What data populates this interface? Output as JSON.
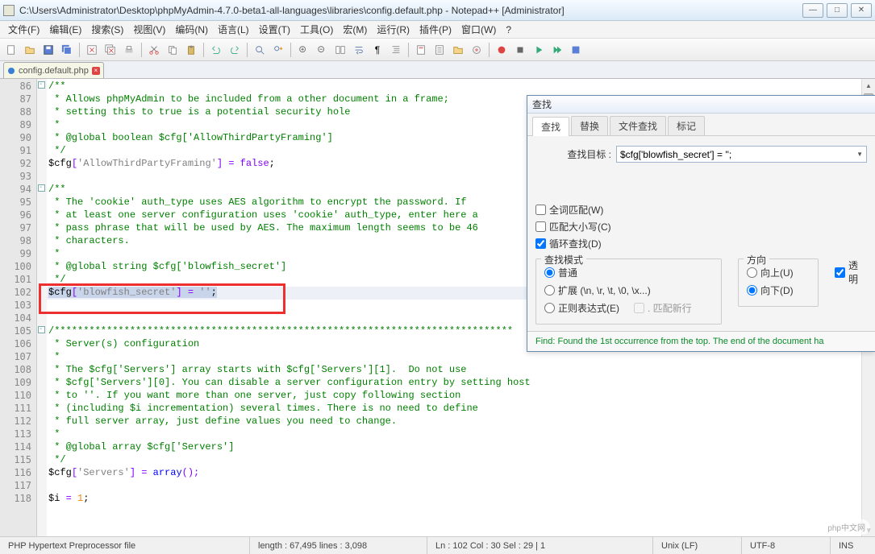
{
  "window": {
    "title": "C:\\Users\\Administrator\\Desktop\\phpMyAdmin-4.7.0-beta1-all-languages\\libraries\\config.default.php - Notepad++ [Administrator]"
  },
  "menu": {
    "items": [
      "文件(F)",
      "编辑(E)",
      "搜索(S)",
      "视图(V)",
      "编码(N)",
      "语言(L)",
      "设置(T)",
      "工具(O)",
      "宏(M)",
      "运行(R)",
      "插件(P)",
      "窗口(W)",
      "?"
    ]
  },
  "tab": {
    "filename": "config.default.php"
  },
  "code": {
    "lines": [
      {
        "n": 86,
        "cls": "c-comment",
        "t": "/**"
      },
      {
        "n": 87,
        "cls": "c-comment",
        "t": " * Allows phpMyAdmin to be included from a other document in a frame;"
      },
      {
        "n": 88,
        "cls": "c-comment",
        "t": " * setting this to true is a potential security hole"
      },
      {
        "n": 89,
        "cls": "c-comment",
        "t": " *"
      },
      {
        "n": 90,
        "cls": "c-comment",
        "t": " * @global boolean $cfg['AllowThirdPartyFraming']"
      },
      {
        "n": 91,
        "cls": "c-comment",
        "t": " */"
      },
      {
        "n": 92,
        "cls": "",
        "t": ""
      },
      {
        "n": 93,
        "cls": "",
        "t": ""
      },
      {
        "n": 94,
        "cls": "c-comment",
        "t": "/**"
      },
      {
        "n": 95,
        "cls": "c-comment",
        "t": " * The 'cookie' auth_type uses AES algorithm to encrypt the password. If"
      },
      {
        "n": 96,
        "cls": "c-comment",
        "t": " * at least one server configuration uses 'cookie' auth_type, enter here a"
      },
      {
        "n": 97,
        "cls": "c-comment",
        "t": " * pass phrase that will be used by AES. The maximum length seems to be 46"
      },
      {
        "n": 98,
        "cls": "c-comment",
        "t": " * characters."
      },
      {
        "n": 99,
        "cls": "c-comment",
        "t": " *"
      },
      {
        "n": 100,
        "cls": "c-comment",
        "t": " * @global string $cfg['blowfish_secret']"
      },
      {
        "n": 101,
        "cls": "c-comment",
        "t": " */"
      },
      {
        "n": 102,
        "cls": "",
        "t": ""
      },
      {
        "n": 103,
        "cls": "",
        "t": ""
      },
      {
        "n": 104,
        "cls": "",
        "t": ""
      },
      {
        "n": 105,
        "cls": "c-comment",
        "t": "/*******************************************************************************"
      },
      {
        "n": 106,
        "cls": "c-comment",
        "t": " * Server(s) configuration"
      },
      {
        "n": 107,
        "cls": "c-comment",
        "t": " *"
      },
      {
        "n": 108,
        "cls": "c-comment",
        "t": " * The $cfg['Servers'] array starts with $cfg['Servers'][1].  Do not use"
      },
      {
        "n": 109,
        "cls": "c-comment",
        "t": " * $cfg['Servers'][0]. You can disable a server configuration entry by setting host"
      },
      {
        "n": 110,
        "cls": "c-comment",
        "t": " * to ''. If you want more than one server, just copy following section"
      },
      {
        "n": 111,
        "cls": "c-comment",
        "t": " * (including $i incrementation) several times. There is no need to define"
      },
      {
        "n": 112,
        "cls": "c-comment",
        "t": " * full server array, just define values you need to change."
      },
      {
        "n": 113,
        "cls": "c-comment",
        "t": " *"
      },
      {
        "n": 114,
        "cls": "c-comment",
        "t": " * @global array $cfg['Servers']"
      },
      {
        "n": 115,
        "cls": "c-comment",
        "t": " */"
      },
      {
        "n": 116,
        "cls": "",
        "t": ""
      },
      {
        "n": 117,
        "cls": "",
        "t": ""
      },
      {
        "n": 118,
        "cls": "",
        "t": ""
      }
    ],
    "line92": {
      "var": "$cfg",
      "b1": "[",
      "s": "'AllowThirdPartyFraming'",
      "b2": "]",
      "eq": " = ",
      "val": "false",
      "semi": ";"
    },
    "line102": {
      "var": "$cfg",
      "b1": "[",
      "s": "'blowfish_secret'",
      "b2": "]",
      "eq": " = ",
      "val": "''",
      "semi": ";"
    },
    "line116": {
      "var": "$cfg",
      "b1": "[",
      "s": "'Servers'",
      "b2": "]",
      "eq": " = ",
      "fn": "array",
      "p": "();"
    },
    "line118": {
      "var": "$i",
      "eq": " = ",
      "val": "1",
      "semi": ";"
    }
  },
  "find": {
    "title": "查找",
    "tabs": [
      "查找",
      "替换",
      "文件查找",
      "标记"
    ],
    "targetLabel": "查找目标 :",
    "targetValue": "$cfg['blowfish_secret'] = '';",
    "wholeWord": "全词匹配(W)",
    "matchCase": "匹配大小写(C)",
    "wrap": "循环查找(D)",
    "modeTitle": "查找模式",
    "modeNormal": "普通",
    "modeExtended": "扩展 (\\n, \\r, \\t, \\0, \\x...)",
    "modeRegex": "正则表达式(E)",
    "regexNewline": ". 匹配新行",
    "dirTitle": "方向",
    "dirUp": "向上(U)",
    "dirDown": "向下(D)",
    "transparent": "透明",
    "status": "Find: Found the 1st occurrence from the top. The end of the document ha"
  },
  "status": {
    "filetype": "PHP Hypertext Preprocessor file",
    "length": "length : 67,495    lines : 3,098",
    "pos": "Ln : 102    Col : 30    Sel : 29 | 1",
    "lineEnding": "Unix (LF)",
    "encoding": "UTF-8",
    "ins": "INS"
  },
  "watermark": "php中文网"
}
